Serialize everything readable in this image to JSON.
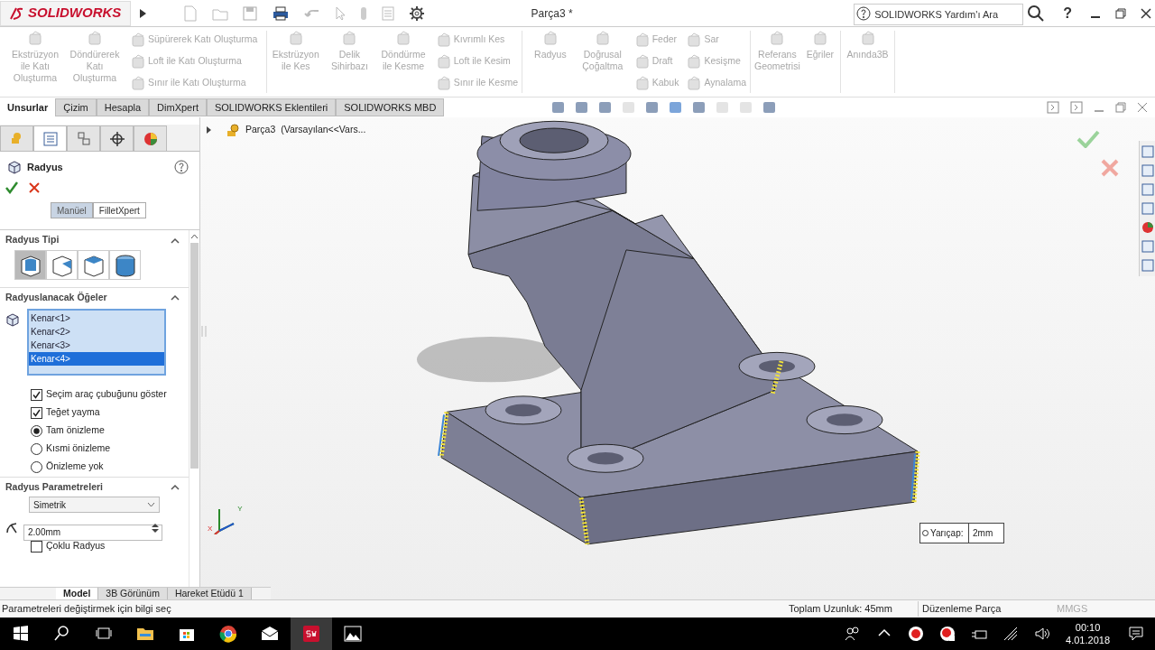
{
  "app": {
    "logo": "SOLIDWORKS",
    "title": "Parça3 *",
    "help_search": {
      "placeholder": "SOLIDWORKS Yardım'ı Ara"
    },
    "help_button": "?"
  },
  "ribbon": {
    "groups": [
      {
        "large": [
          "Ekstrüzyon ile Katı Oluşturma",
          "Döndürerek Katı Oluşturma"
        ],
        "small": [
          "Süpürerek Katı Oluşturma",
          "Loft ile Katı Oluşturma",
          "Sınır ile Katı Oluşturma"
        ]
      },
      {
        "large": [
          "Ekstrüzyon ile Kes",
          "Delik Sihirbazı",
          "Döndürme ile Kesme"
        ],
        "small": [
          "Kıvrımlı Kes",
          "Loft ile Kesim",
          "Sınır ile Kesme"
        ]
      },
      {
        "large": [
          "Radyus",
          "Doğrusal Çoğaltma"
        ],
        "small": [
          "Feder",
          "Draft",
          "Kabuk",
          "Sar",
          "Kesişme",
          "Aynalama"
        ]
      },
      {
        "large": [
          "Referans Geometrisi",
          "Eğriler"
        ]
      },
      {
        "large": [
          "Anında3B"
        ]
      }
    ]
  },
  "tabs": [
    {
      "label": "Unsurlar",
      "selected": true
    },
    {
      "label": "Çizim",
      "selected": false
    },
    {
      "label": "Hesapla",
      "selected": false
    },
    {
      "label": "DimXpert",
      "selected": false
    },
    {
      "label": "SOLIDWORKS Eklentileri",
      "selected": false
    },
    {
      "label": "SOLIDWORKS MBD",
      "selected": false
    }
  ],
  "feature_tree": {
    "part": "Parça3",
    "config": "(Varsayılan<<Vars..."
  },
  "property_manager": {
    "panel_tabs": [
      {
        "selected": false
      },
      {
        "selected": true
      },
      {
        "selected": false
      },
      {
        "selected": false
      },
      {
        "selected": false
      }
    ],
    "title": "Radyus",
    "modes": [
      {
        "label": "Manüel",
        "selected": true
      },
      {
        "label": "FilletXpert",
        "selected": false
      }
    ],
    "sections": [
      {
        "title": "Radyus Tipi",
        "kind": "types",
        "types": [
          {
            "selected": true
          },
          {
            "selected": false
          },
          {
            "selected": false
          },
          {
            "selected": false
          }
        ]
      },
      {
        "title": "Radyuslanacak Öğeler",
        "kind": "items",
        "items": [
          {
            "label": "Kenar<1>",
            "selected": false
          },
          {
            "label": "Kenar<2>",
            "selected": false
          },
          {
            "label": "Kenar<3>",
            "selected": false
          },
          {
            "label": "Kenar<4>",
            "selected": true
          }
        ],
        "options": [
          {
            "kind": "checkbox",
            "label": "Seçim araç çubuğunu göster",
            "checked": true
          },
          {
            "kind": "checkbox",
            "label": "Teğet yayma",
            "checked": true
          },
          {
            "kind": "radio",
            "label": "Tam önizleme",
            "selected": true
          },
          {
            "kind": "radio",
            "label": "Kısmi önizleme",
            "selected": false
          },
          {
            "kind": "radio",
            "label": "Önizleme yok",
            "selected": false
          }
        ]
      },
      {
        "title": "Radyus Parametreleri",
        "kind": "params",
        "dropdown": "Simetrik",
        "value": "2.00mm",
        "options": [
          {
            "kind": "checkbox",
            "label": "Çoklu Radyus",
            "checked": false
          }
        ]
      }
    ]
  },
  "viewport": {
    "axis_x": "X",
    "axis_y": "Y",
    "callout": {
      "label": "Yarıçap:",
      "value": "2mm"
    }
  },
  "bottom_tabs": [
    {
      "label": "Model",
      "selected": true
    },
    {
      "label": "3B Görünüm",
      "selected": false
    },
    {
      "label": "Hareket Etüdü 1",
      "selected": false
    }
  ],
  "status_bar": {
    "message": "Parametreleri değiştirmek için bilgi seç",
    "length": "Toplam Uzunluk: 45mm",
    "mode": "Düzenleme Parça",
    "units": "MMGS"
  },
  "taskbar": {
    "time": "00:10",
    "date": "4.01.2018"
  }
}
